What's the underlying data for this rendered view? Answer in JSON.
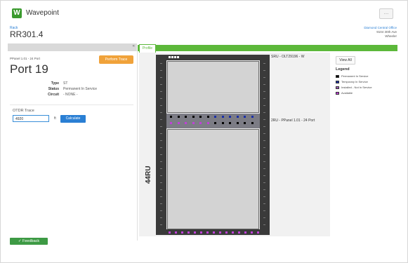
{
  "app": {
    "title": "Wavepoint",
    "logo_letter": "W",
    "menu_label": "..."
  },
  "breadcrumb": "Rack",
  "rack_id": "RR301.4",
  "location": {
    "name": "Diamond Central Office",
    "address": "9104 30th Ave",
    "city": "Wheeler"
  },
  "left_panel": {
    "collapse_label": "«",
    "panel_label": "PPanel 1.01 - 24 Port",
    "title": "Port 19",
    "trace_button": "Perform Trace",
    "fields": [
      {
        "key": "Type",
        "value": "ST"
      },
      {
        "key": "Status",
        "value": "Permanent In Service"
      },
      {
        "key": "Circuit",
        "value": "- NONE -"
      }
    ],
    "otdr": {
      "title": "OTDR Trace",
      "value": "4920",
      "unit": "ft",
      "button": "Calculate"
    }
  },
  "tab_label": "Profile",
  "rack": {
    "units_label": "44RU",
    "devices": [
      {
        "label": "SRU - OLT29196 - W"
      },
      {
        "label": "2RU - PPanel 1.01 - 24 Port"
      }
    ]
  },
  "legend": {
    "view_all": "View All",
    "title": "Legend",
    "items": [
      {
        "label": "Permanent In Service",
        "color": "#000000"
      },
      {
        "label": "Temporary In Service",
        "color": "#1a2fa8"
      },
      {
        "label": "Installed - Not In Service",
        "color": "#9b59b6"
      },
      {
        "label": "Available",
        "color": "#c040d8"
      }
    ]
  },
  "feedback_label": "Feedback"
}
